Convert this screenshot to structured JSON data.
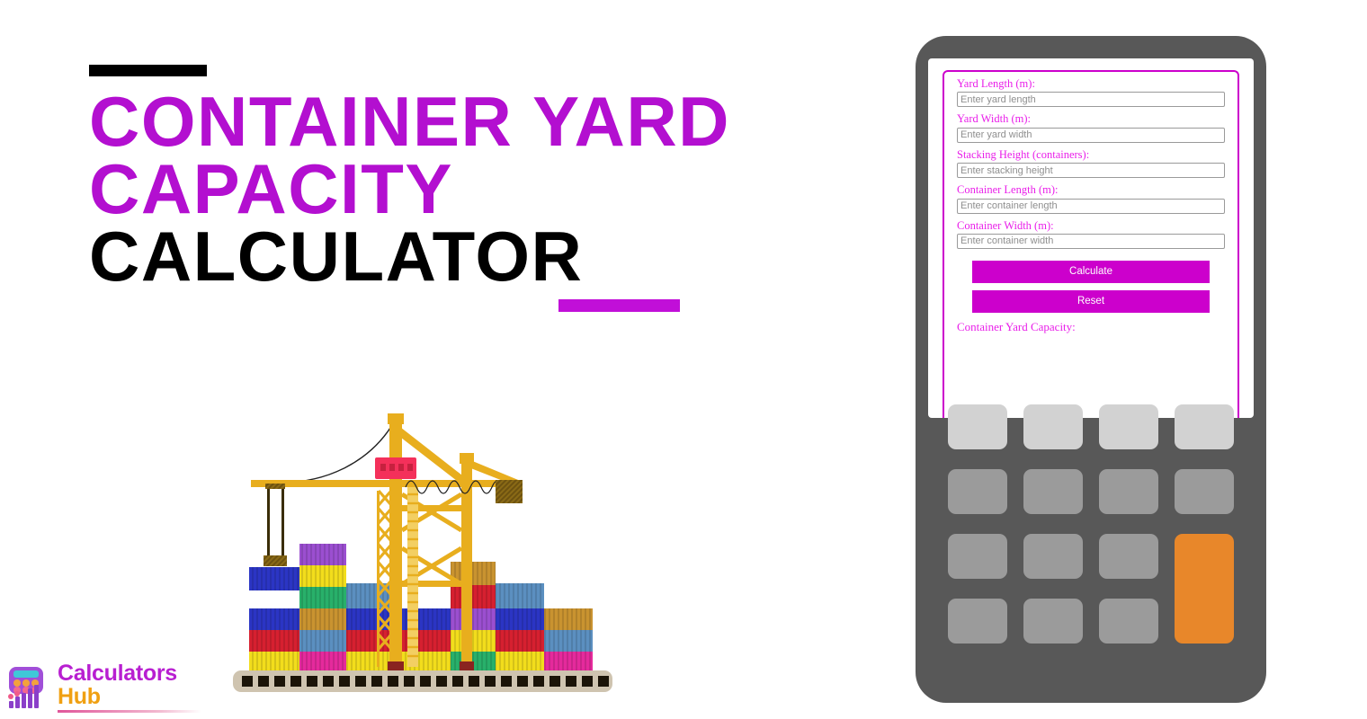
{
  "page": {
    "background": "#ffffff",
    "accent_magenta": "#b30fd0",
    "accent_magenta_bright": "#cc00cc",
    "accent_orange": "#e8872a",
    "device_gray": "#585858"
  },
  "title": {
    "line1": "CONTAINER YARD",
    "line2": "CAPACITY",
    "line3": "CALCULATOR",
    "top_rule_color": "#000000",
    "bottom_rule_color": "#c10fd8"
  },
  "illustration": {
    "name": "container-yard-crane-illustration",
    "crane_color": "#e8ae1e",
    "cab_color": "#f4305a",
    "ground_color": "#cfc4b0",
    "container_colors": [
      "#2b35c4",
      "#d62030",
      "#f2dd1c",
      "#e52a9c",
      "#5b8fc0",
      "#28b06a",
      "#9b4fd0",
      "#c99330"
    ]
  },
  "logo": {
    "line1": "Calculators",
    "line2": "Hub",
    "line1_color": "#b81fd1",
    "line2_color": "#f0a012"
  },
  "calculator": {
    "form": {
      "fields": [
        {
          "label": "Yard Length (m):",
          "placeholder": "Enter yard length",
          "value": ""
        },
        {
          "label": "Yard Width (m):",
          "placeholder": "Enter yard width",
          "value": ""
        },
        {
          "label": "Stacking Height (containers):",
          "placeholder": "Enter stacking height",
          "value": ""
        },
        {
          "label": "Container Length (m):",
          "placeholder": "Enter container length",
          "value": ""
        },
        {
          "label": "Container Width (m):",
          "placeholder": "Enter container width",
          "value": ""
        }
      ],
      "calculate_label": "Calculate",
      "reset_label": "Reset",
      "result_label": "Container Yard Capacity:",
      "result_value": ""
    },
    "keypad": {
      "rows": [
        [
          "key-1",
          "key-2",
          "key-3",
          "key-4"
        ],
        [
          "key-5",
          "key-6",
          "key-7",
          "key-8"
        ],
        [
          "key-9",
          "key-10",
          "key-11",
          "key-equals"
        ],
        [
          "key-12",
          "key-13",
          "key-14"
        ]
      ]
    }
  }
}
